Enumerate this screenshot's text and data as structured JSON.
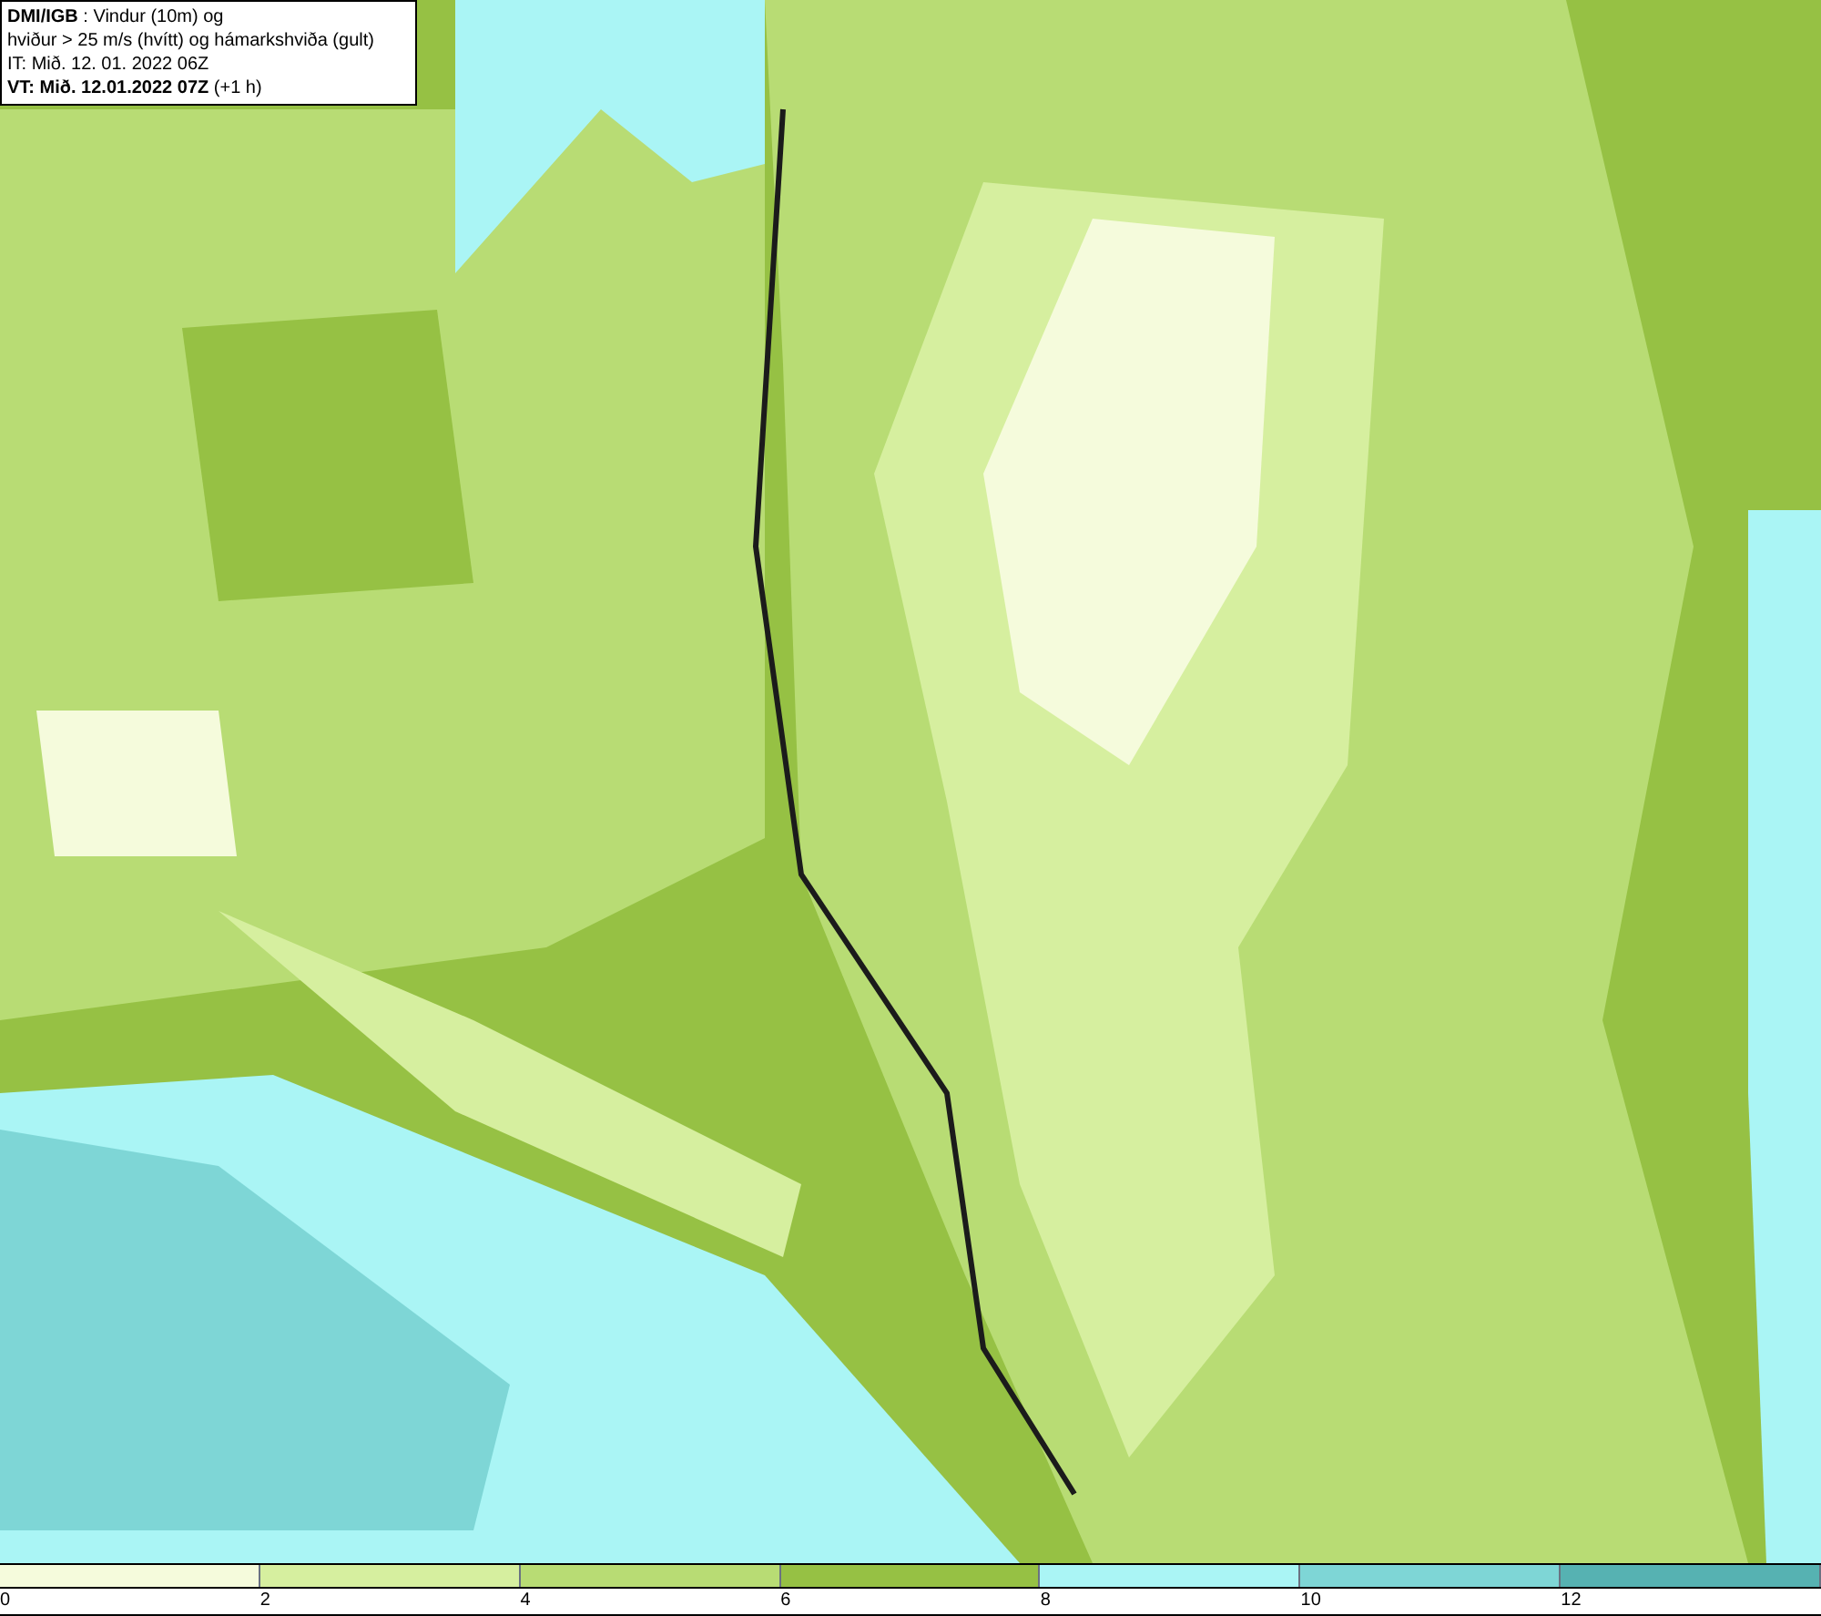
{
  "title_box": {
    "lines": [
      "**DMI/IGB** : Vindur (10m) og",
      "hviður > 25 m/s (hvítt) og hámarkshviða (gult)",
      "IT: Mið. 12. 01. 2022 06Z",
      "**VT: Mið. 12.01.2022 07Z** (+1 h)"
    ]
  },
  "legend": [
    {
      "label": "0",
      "color": "#f5fbdc"
    },
    {
      "label": "2",
      "color": "#d6ef9f"
    },
    {
      "label": "4",
      "color": "#b8dc74"
    },
    {
      "label": "6",
      "color": "#96c144"
    },
    {
      "label": "8",
      "color": "#aaf5f5"
    },
    {
      "label": "10",
      "color": "#7ed6d6"
    },
    {
      "label": "12",
      "color": "#56b2b2"
    }
  ]
}
